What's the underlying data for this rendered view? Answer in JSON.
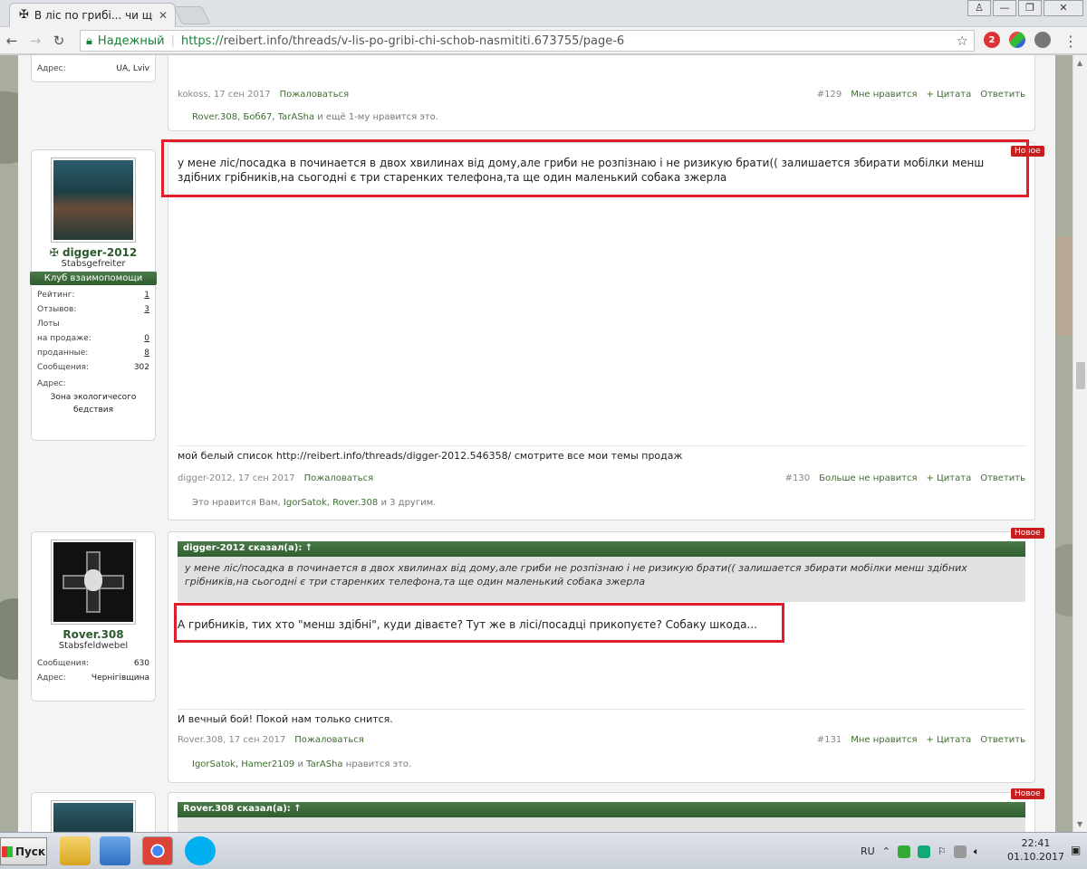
{
  "browser": {
    "tab_title": "В ліс по грибі... чи щоб",
    "tab_favicon": "iron-cross-icon",
    "window_buttons": {
      "user": "♙",
      "min": "—",
      "max": "❐",
      "close": "✕"
    },
    "secure_label": "Надежный",
    "url_scheme": "https://",
    "url_rest": "reibert.info/threads/v-lis-po-gribi-chi-schob-nasmititi.673755/page-6",
    "ext_badge": "2"
  },
  "prev_post": {
    "addr_label": "Адрес:",
    "addr_value": "UA, Lviv",
    "meta_author": "kokoss, 17 сен 2017",
    "meta_report": "Пожаловаться",
    "meta_num": "#129",
    "meta_like": "Мне нравится",
    "meta_quote": "+ Цитата",
    "meta_reply": "Ответить",
    "likes_users": "Rover.308, Боб67, TarASha",
    "likes_tail": " и ещё 1-му нравится это."
  },
  "post130": {
    "badge": "Новое",
    "username": "digger-2012",
    "rank": "Stabsgefreiter",
    "club": "Клуб взаимопомощи",
    "stats": [
      {
        "label": "Рейтинг:",
        "value": "1",
        "link": true
      },
      {
        "label": "Отзывов:",
        "value": "3",
        "link": true
      },
      {
        "label": "Лоты",
        "value": "",
        "link": false
      },
      {
        "label": "  на продаже:",
        "value": "0",
        "link": true
      },
      {
        "label": "  проданные:",
        "value": "8",
        "link": true
      },
      {
        "label": "Сообщения:",
        "value": "302",
        "link": false
      }
    ],
    "addr_label": "Адрес:",
    "addr_value": "Зона экологичесого бедствия",
    "text_line1": "у мене ліс/посадка в починается в двох хвилинах від дому,але гриби не розпізнаю і не ризикую брати(( залишается збирати мобілки менш",
    "text_line2": "здібних грібників,на сьогодні є три старенких телефона,та ще один маленький собака зжерла",
    "signature": "мой белый список http://reibert.info/threads/digger-2012.546358/ смотрите все мои темы продаж",
    "meta_author": "digger-2012, 17 сен 2017",
    "meta_report": "Пожаловаться",
    "meta_num": "#130",
    "meta_like": "Больше не нравится",
    "meta_quote": "+ Цитата",
    "meta_reply": "Ответить",
    "likes_prefix": "Это нравится Вам, ",
    "likes_users": "IgorSatok, Rover.308",
    "likes_tail": " и 3 другим."
  },
  "post131": {
    "badge": "Новое",
    "username": "Rover.308",
    "rank": "Stabsfeldwebel",
    "stats": [
      {
        "label": "Сообщения:",
        "value": "630",
        "link": false
      },
      {
        "label": "Адрес:",
        "value": "Чернігівщина",
        "link": false
      }
    ],
    "quote_header": "digger-2012 сказал(а): ↑",
    "quote_line1": "у мене ліс/посадка в починается в двох хвилинах від дому,але гриби не розпізнаю і не ризикую брати(( залишается збирати мобілки менш здібних",
    "quote_line2": "грібників,на сьогодні є три старенких телефона,та ще один маленький собака зжерла",
    "text": "А грибників, тих хто \"менш здібні\", куди діваєте? Тут же в лісі/посадці прикопуєте? Собаку шкода...",
    "signature": "И вечный бой! Покой нам только снится.",
    "meta_author": "Rover.308, 17 сен 2017",
    "meta_report": "Пожаловаться",
    "meta_num": "#131",
    "meta_like": "Мне нравится",
    "meta_quote": "+ Цитата",
    "meta_reply": "Ответить",
    "likes_users": "IgorSatok, Hamer2109",
    "likes_mid": " и ",
    "likes_user2": "TarASha",
    "likes_tail": " нравится это."
  },
  "post132": {
    "badge": "Новое",
    "quote_header": "Rover.308 сказал(а): ↑"
  },
  "taskbar": {
    "start_label": "Пуск",
    "lang": "RU",
    "time": "22:41",
    "date": "01.10.2017"
  },
  "colors": {
    "accent_green": "#3d6e2f",
    "highlight_red": "#e21d2a",
    "badge_red": "#c81e1e"
  }
}
